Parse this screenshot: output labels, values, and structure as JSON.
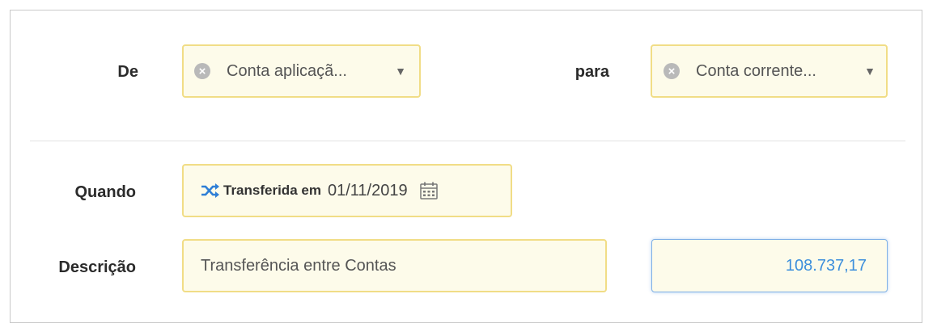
{
  "from": {
    "label": "De",
    "selected": "Conta aplicaçã..."
  },
  "to": {
    "label": "para",
    "selected": "Conta corrente..."
  },
  "when": {
    "label": "Quando",
    "status_text": "Transferida em",
    "date": "01/11/2019"
  },
  "description": {
    "label": "Descrição",
    "value": "Transferência entre Contas"
  },
  "amount": {
    "value": "108.737,17"
  },
  "icons": {
    "clear": "clear-icon",
    "dropdown": "chevron-down-icon",
    "shuffle": "shuffle-icon",
    "calendar": "calendar-icon"
  },
  "colors": {
    "field_bg": "#fdfbea",
    "field_border": "#f1dd86",
    "accent": "#3d8fdc",
    "shuffle": "#2f7fd6"
  }
}
